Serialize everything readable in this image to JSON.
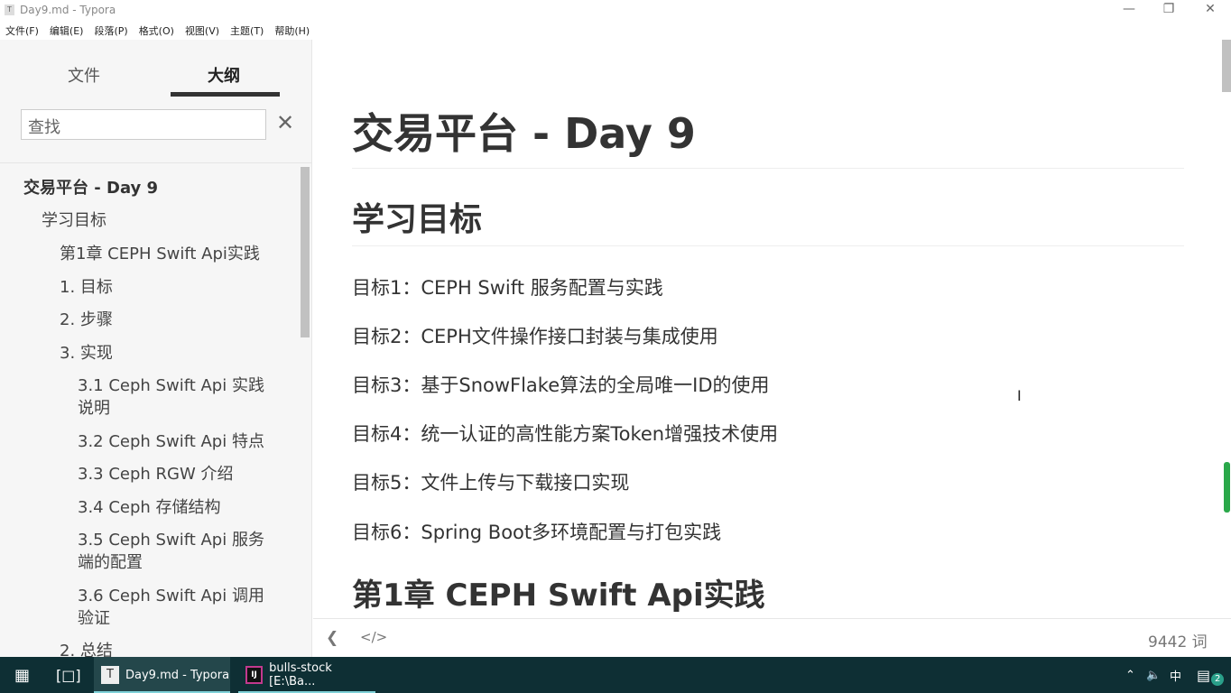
{
  "window": {
    "title": "Day9.md - Typora",
    "app_icon": "T"
  },
  "menu": [
    "文件(F)",
    "编辑(E)",
    "段落(P)",
    "格式(O)",
    "视图(V)",
    "主题(T)",
    "帮助(H)"
  ],
  "sidebar": {
    "tabs": [
      "文件",
      "大纲"
    ],
    "active_tab": "大纲",
    "search_placeholder": "查找",
    "outline": [
      {
        "label": "交易平台 - Day 9",
        "level": 1
      },
      {
        "label": "学习目标",
        "level": 2
      },
      {
        "label": "第1章 CEPH Swift Api实践",
        "level": 3
      },
      {
        "label": "1. 目标",
        "level": 3
      },
      {
        "label": "2. 步骤",
        "level": 3
      },
      {
        "label": "3. 实现",
        "level": 3
      },
      {
        "label": "3.1 Ceph Swift Api 实践说明",
        "level": 4
      },
      {
        "label": "3.2 Ceph Swift Api 特点",
        "level": 4
      },
      {
        "label": "3.3 Ceph RGW 介绍",
        "level": 4
      },
      {
        "label": "3.4 Ceph 存储结构",
        "level": 4
      },
      {
        "label": "3.5 Ceph Swift Api 服务端的配置",
        "level": 4
      },
      {
        "label": "3.6 Ceph Swift Api 调用验证",
        "level": 4
      },
      {
        "label": "2. 总结",
        "level": 3
      }
    ]
  },
  "document": {
    "h1": "交易平台 - Day 9",
    "h2_goals": "学习目标",
    "goals": [
      "目标1：CEPH Swift  服务配置与实践",
      "目标2：CEPH文件操作接口封装与集成使用",
      "目标3：基于SnowFlake算法的全局唯一ID的使用",
      "目标4：统一认证的高性能方案Token增强技术使用",
      "目标5：文件上传与下载接口实现",
      "目标6：Spring Boot多环境配置与打包实践"
    ],
    "h2_chapter1": "第1章 CEPH Swift Api实践"
  },
  "footer": {
    "word_count": "9442 词"
  },
  "taskbar": {
    "items": [
      "Day9.md - Typora",
      "bulls-stock [E:\\Ba..."
    ],
    "ime": "中",
    "notifications": "2"
  }
}
